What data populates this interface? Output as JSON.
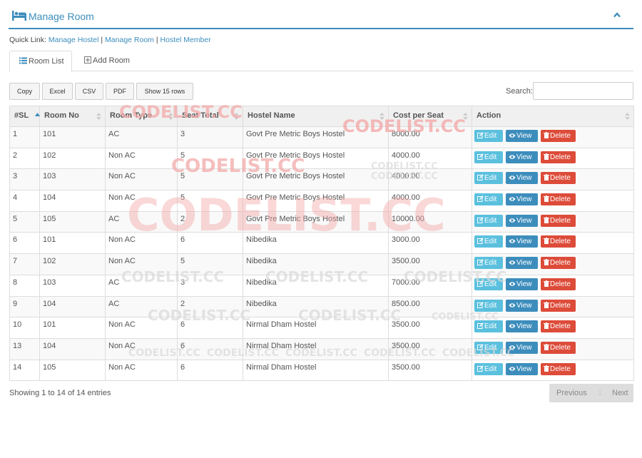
{
  "header": {
    "title": "Manage Room"
  },
  "quick_links": {
    "prefix": "Quick Link:",
    "items": [
      "Manage Hostel",
      "Manage Room",
      "Hostel Member"
    ],
    "separator": "|"
  },
  "tabs": [
    {
      "label": "Room List",
      "icon": "list-icon",
      "active": true
    },
    {
      "label": "Add Room",
      "icon": "plus-square-icon",
      "active": false
    }
  ],
  "toolbar": {
    "buttons": [
      "Copy",
      "Excel",
      "CSV",
      "PDF",
      "Show 15 rows"
    ],
    "search_label": "Search:",
    "search_value": ""
  },
  "table": {
    "columns": [
      "#SL",
      "Room No",
      "Room Type",
      "Seat Total",
      "Hostel Name",
      "Cost per Seat",
      "Action"
    ],
    "rows": [
      [
        "1",
        "101",
        "AC",
        "3",
        "Govt Pre Metric Boys Hostel",
        "8000.00"
      ],
      [
        "2",
        "102",
        "Non AC",
        "5",
        "Govt Pre Metric Boys Hostel",
        "4000.00"
      ],
      [
        "3",
        "103",
        "Non AC",
        "5",
        "Govt Pre Metric Boys Hostel",
        "4000.00"
      ],
      [
        "4",
        "104",
        "Non AC",
        "5",
        "Govt Pre Metric Boys Hostel",
        "4000.00"
      ],
      [
        "5",
        "105",
        "AC",
        "2",
        "Govt Pre Metric Boys Hostel",
        "10000.00"
      ],
      [
        "6",
        "101",
        "Non AC",
        "6",
        "Nibedika",
        "3000.00"
      ],
      [
        "7",
        "102",
        "Non AC",
        "5",
        "Nibedika",
        "3500.00"
      ],
      [
        "8",
        "103",
        "AC",
        "3",
        "Nibedika",
        "7000.00"
      ],
      [
        "9",
        "104",
        "AC",
        "2",
        "Nibedika",
        "8500.00"
      ],
      [
        "10",
        "101",
        "Non AC",
        "6",
        "Nirmal Dham Hostel",
        "3500.00"
      ],
      [
        "13",
        "104",
        "Non AC",
        "6",
        "Nirmal Dham Hostel",
        "3500.00"
      ],
      [
        "14",
        "105",
        "Non AC",
        "6",
        "Nirmal Dham Hostel",
        "3500.00"
      ]
    ],
    "actions": {
      "edit": "Edit",
      "view": "View",
      "delete": "Delete"
    }
  },
  "footer": {
    "info": "Showing 1 to 14 of 14 entries",
    "prev": "Previous",
    "page": "1",
    "next": "Next"
  },
  "watermark": {
    "text": "CODELIST.CC"
  },
  "colors": {
    "accent": "#3c8dbc",
    "edit": "#5bc0de",
    "view": "#3c8dbc",
    "delete": "#dd4b39",
    "watermark": "#f4a9a9"
  }
}
